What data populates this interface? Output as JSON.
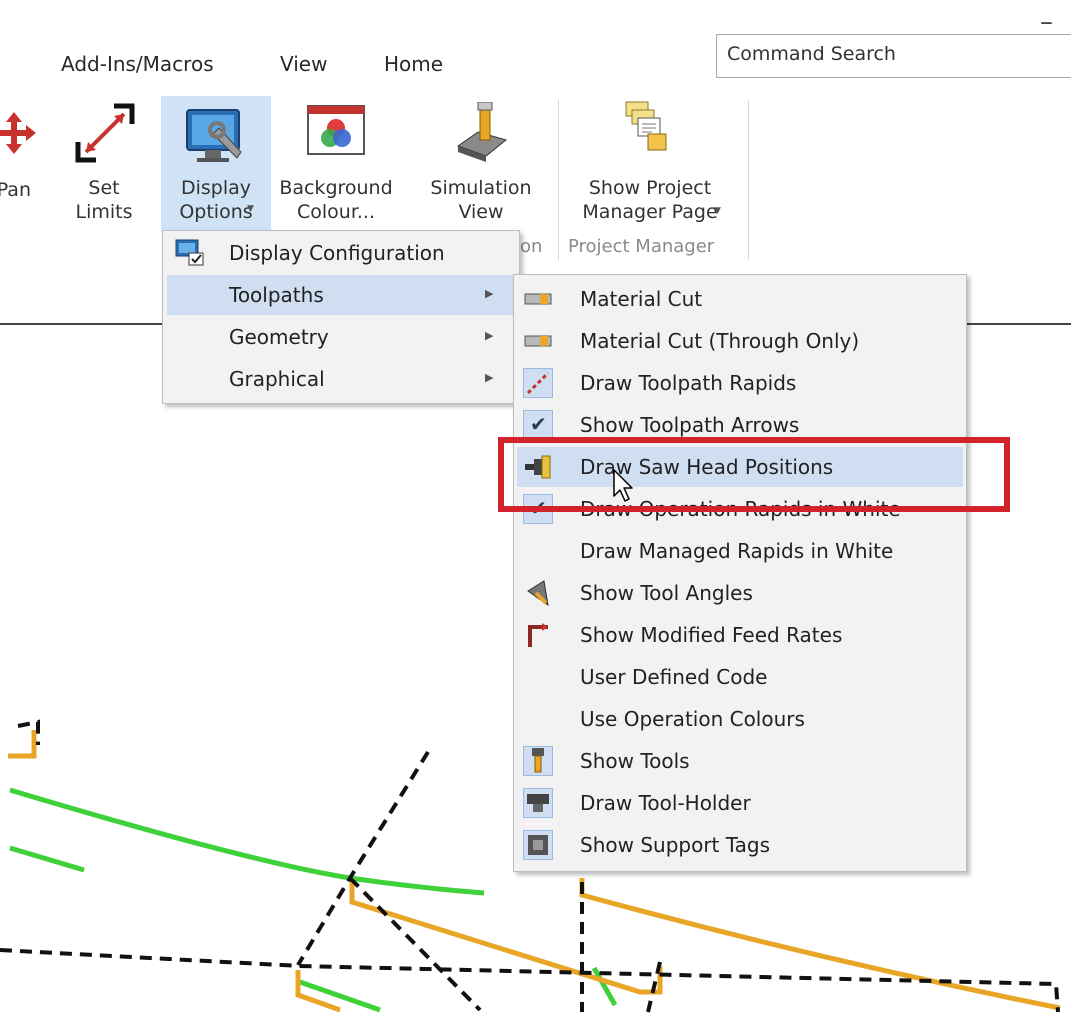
{
  "menubar": {
    "tabs": [
      "Add-Ins/Macros",
      "View",
      "Home"
    ],
    "search_placeholder": "Command Search"
  },
  "ribbon": {
    "pan_label": "Pan",
    "set_limits_label": "Set\nLimits",
    "display_options_label": "Display\nOptions",
    "background_colour_label": "Background\nColour...",
    "simulation_view_label": "Simulation\nView",
    "show_project_manager_label": "Show Project\nManager Page",
    "group_simulation_fragment": "on",
    "group_project_manager": "Project Manager"
  },
  "display_options_menu": {
    "items": [
      {
        "label": "Display Configuration",
        "icon": "display-config-icon",
        "submenu": false
      },
      {
        "label": "Toolpaths",
        "icon": "",
        "submenu": true,
        "hover": true
      },
      {
        "label": "Geometry",
        "icon": "",
        "submenu": true
      },
      {
        "label": "Graphical",
        "icon": "",
        "submenu": true
      }
    ]
  },
  "toolpaths_submenu": {
    "items": [
      {
        "label": "Material Cut",
        "icon": "material-cut-icon"
      },
      {
        "label": "Material Cut (Through Only)",
        "icon": "material-cut-through-icon"
      },
      {
        "label": "Draw Toolpath Rapids",
        "icon": "toolpath-rapids-icon",
        "checked": true
      },
      {
        "label": "Show Toolpath Arrows",
        "icon": "check-icon",
        "checked": true
      },
      {
        "label": "Draw Saw Head Positions",
        "icon": "saw-head-icon",
        "hover": true
      },
      {
        "label": "Draw Operation Rapids in White",
        "icon": "check-icon",
        "checked": true
      },
      {
        "label": "Draw Managed Rapids in White",
        "icon": ""
      },
      {
        "label": "Show Tool Angles",
        "icon": "tool-angles-icon"
      },
      {
        "label": "Show Modified Feed Rates",
        "icon": "feed-rates-icon"
      },
      {
        "label": "User Defined Code",
        "icon": ""
      },
      {
        "label": "Use Operation Colours",
        "icon": ""
      },
      {
        "label": "Show Tools",
        "icon": "show-tools-icon",
        "checked": true
      },
      {
        "label": "Draw Tool-Holder",
        "icon": "tool-holder-icon",
        "checked": true
      },
      {
        "label": "Show Support Tags",
        "icon": "support-tags-icon",
        "checked": true
      }
    ]
  },
  "colors": {
    "highlight": "#cfdff1",
    "annotation_red": "#d2232a",
    "toolpath_green": "#3fd13a",
    "toolpath_orange": "#e8a526"
  }
}
